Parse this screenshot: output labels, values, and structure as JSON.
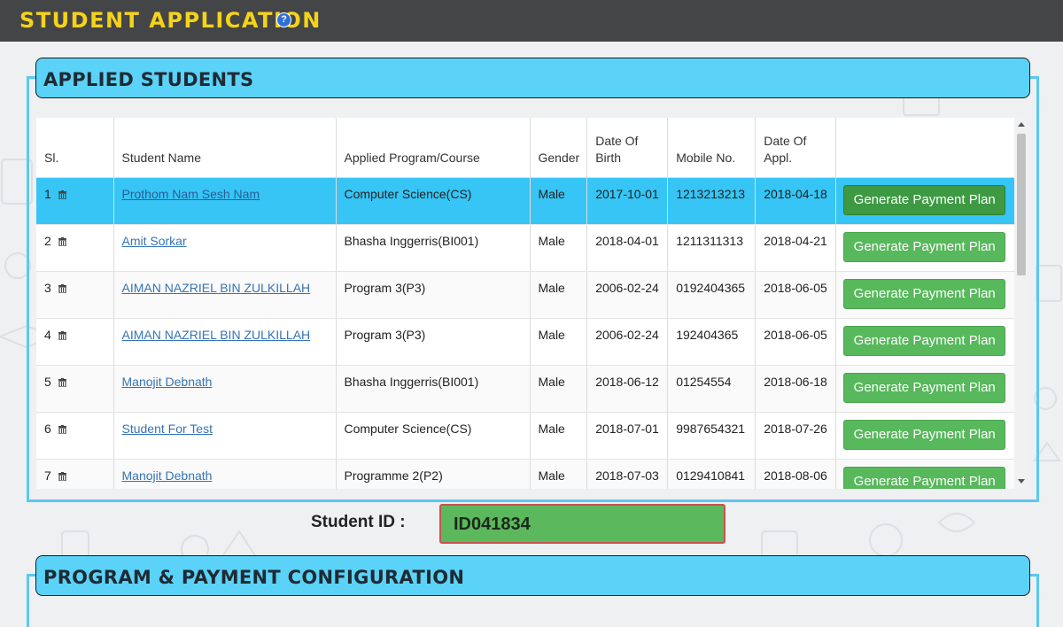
{
  "header": {
    "title": "STUDENT APPLICATION",
    "help_icon": "?"
  },
  "applied_panel": {
    "title": "APPLIED STUDENTS"
  },
  "table": {
    "columns": [
      "Sl.",
      "Student Name",
      "Applied Program/Course",
      "Gender",
      "Date Of Birth",
      "Mobile No.",
      "Date Of Appl.",
      ""
    ],
    "action_label": "Generate Payment Plan",
    "rows": [
      {
        "sl": "1",
        "name": "Prothom Nam Sesh Nam",
        "program": "Computer Science(CS)",
        "gender": "Male",
        "dob": "2017-10-01",
        "mobile": "1213213213",
        "appl": "2018-04-18"
      },
      {
        "sl": "2",
        "name": "Amit Sorkar",
        "program": "Bhasha Inggerris(BI001)",
        "gender": "Male",
        "dob": "2018-04-01",
        "mobile": "1211311313",
        "appl": "2018-04-21"
      },
      {
        "sl": "3",
        "name": "AIMAN NAZRIEL BIN ZULKILLAH",
        "program": "Program 3(P3)",
        "gender": "Male",
        "dob": "2006-02-24",
        "mobile": "0192404365",
        "appl": "2018-06-05"
      },
      {
        "sl": "4",
        "name": "AIMAN NAZRIEL BIN ZULKILLAH",
        "program": "Program 3(P3)",
        "gender": "Male",
        "dob": "2006-02-24",
        "mobile": "192404365",
        "appl": "2018-06-05"
      },
      {
        "sl": "5",
        "name": "Manojit Debnath",
        "program": "Bhasha Inggerris(BI001)",
        "gender": "Male",
        "dob": "2018-06-12",
        "mobile": "01254554",
        "appl": "2018-06-18"
      },
      {
        "sl": "6",
        "name": "Student For Test",
        "program": "Computer Science(CS)",
        "gender": "Male",
        "dob": "2018-07-01",
        "mobile": "9987654321",
        "appl": "2018-07-26"
      },
      {
        "sl": "7",
        "name": "Manojit Debnath",
        "program": "Programme 2(P2)",
        "gender": "Male",
        "dob": "2018-07-03",
        "mobile": "0129410841",
        "appl": "2018-08-06"
      }
    ]
  },
  "student_id": {
    "label": "Student ID :",
    "value": "ID041834"
  },
  "config_panel": {
    "title": "PROGRAM & PAYMENT CONFIGURATION"
  },
  "colors": {
    "accent": "#5bd2f7",
    "selected_row": "#36c5f5",
    "button": "#58b85c",
    "title": "#f5d31a"
  }
}
